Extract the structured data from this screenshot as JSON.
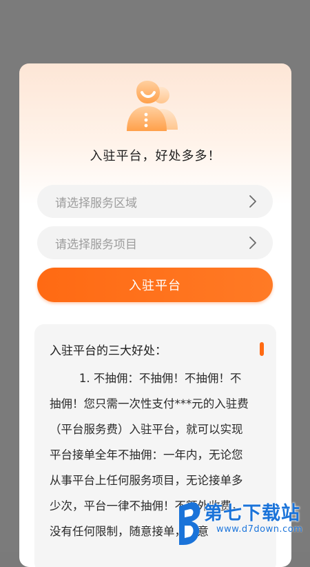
{
  "header": {
    "avatar_icon": "support-agent-icon",
    "title": "入驻平台，好处多多！"
  },
  "form": {
    "region_placeholder": "请选择服务区域",
    "project_placeholder": "请选择服务项目",
    "chevron_icon": "chevron-right-icon",
    "submit_label": "入驻平台"
  },
  "benefits": {
    "title": "入驻平台的三大好处：",
    "body": "1. 不抽佣：不抽佣！不抽佣！不抽佣！您只需一次性支付***元的入驻费（平台服务费）入驻平台，就可以实现平台接单全年不抽佣：一年内，无论您从事平台上任何服务项目，无论接单多少次，平台一律不抽佣！不额外收费，没有任何限制，随意接单，随意"
  },
  "watermark": {
    "text": "第七下载站",
    "url": "www.d7down.com"
  },
  "colors": {
    "accent": "#ff6a13",
    "backdrop": "#7b7b7b",
    "watermark": "#1a73d9"
  }
}
